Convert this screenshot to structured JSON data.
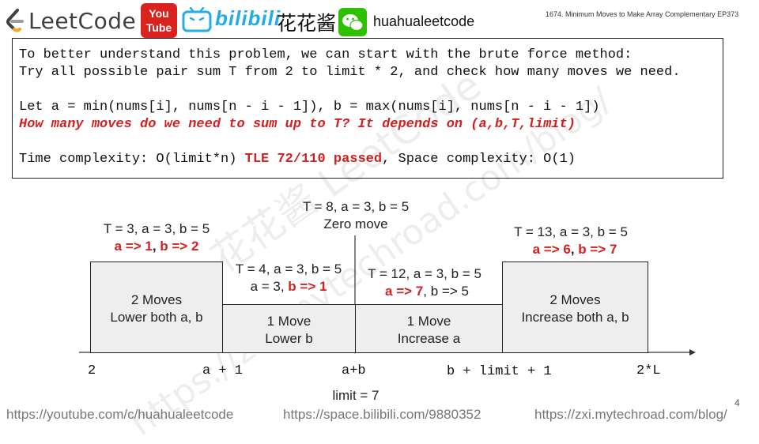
{
  "header": {
    "logo_text": "LeetCode",
    "youtube_top": "You",
    "youtube_bottom": "Tube",
    "bilibili_text": "bilibili",
    "channel_cn": "花花酱",
    "handle": "huahualeetcode",
    "episode": "1674. Minimum Moves to Make Array Complementary EP373"
  },
  "code": {
    "line1": "To better understand this problem, we can start with the brute force method:",
    "line2": "Try all possible pair sum T from 2 to limit * 2, and check how many moves we need.",
    "line3": "Let a = min(nums[i], nums[n - i - 1]), b = max(nums[i], nums[n - i - 1])",
    "line4": "How many moves do we need to sum up to T? It depends on (a,b,T,limit)",
    "line5_a": "Time complexity: O(limit*n) ",
    "line5_b": "TLE 72/110 passed",
    "line5_c": ", Space complexity: O(1)"
  },
  "diagram": {
    "top_center_1": "T = 8, a = 3, b = 5",
    "top_center_2": "Zero move",
    "left_case_1": "T = 3, a = 3, b = 5",
    "left_case_2a": "a => 1",
    "left_case_2sep": ", ",
    "left_case_2b": "b => 2",
    "right_case_1": "T = 13, a = 3, b = 5",
    "right_case_2a": "a => 6",
    "right_case_2sep": ", ",
    "right_case_2b": "b => 7",
    "mid_left_1": "T = 4, a = 3, b = 5",
    "mid_left_2a": "a = 3, ",
    "mid_left_2b": "b => 1",
    "mid_right_1": "T = 12, a = 3, b = 5",
    "mid_right_2a": "a => 7",
    "mid_right_2b": ", b => 5",
    "box1": "2 Moves\nLower both a, b",
    "box2": "1 Move\nLower b",
    "box3": "1 Move\nIncrease a",
    "box4": "2 Moves\nIncrease both a, b",
    "axis_labels": [
      "2",
      "a + 1",
      "a+b",
      "b + limit + 1",
      "2*L"
    ],
    "limit_note": "limit = 7",
    "page_number": "4"
  },
  "footer": {
    "youtube_url": "https://youtube.com/c/huahualeetcode",
    "bilibili_url": "https://space.bilibili.com/9880352",
    "blog_url": "https://zxi.mytechroad.com/blog/"
  },
  "watermark": {
    "text1": "花花酱 LeetCode",
    "text2": "https://zxi.mytechroad.com/blog/"
  },
  "colors": {
    "accent_red": "#d32020",
    "box_fill": "#eeeeee",
    "bilibili_blue": "#23ade5",
    "youtube_red": "#d8231f",
    "wechat_green": "#2dc100"
  }
}
